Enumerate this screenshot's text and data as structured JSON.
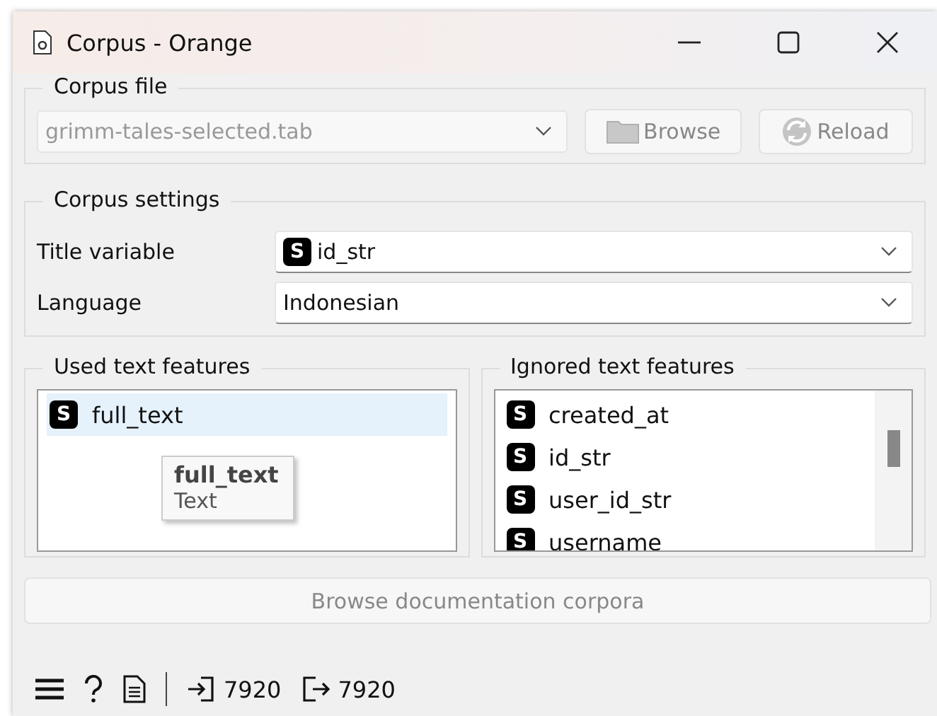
{
  "window": {
    "title": "Corpus - Orange"
  },
  "corpus_file": {
    "title": "Corpus file",
    "file": "grimm-tales-selected.tab",
    "disabled": true,
    "buttons": [
      {
        "label": "Browse",
        "kind": "folder"
      },
      {
        "label": "Reload",
        "kind": "reload"
      }
    ]
  },
  "corpus_settings": {
    "title": "Corpus settings",
    "fields": [
      {
        "label": "Title variable",
        "value": "id_str",
        "type": "S"
      },
      {
        "label": "Language",
        "value": "Indonesian"
      }
    ]
  },
  "used_features": {
    "title": "Used text features",
    "items": [
      {
        "type": "S",
        "name": "full_text",
        "selected": true
      }
    ]
  },
  "tooltip": {
    "title": "full_text",
    "subtitle": "Text"
  },
  "ignored_features": {
    "title": "Ignored text features",
    "items": [
      {
        "type": "S",
        "name": "created_at",
        "selected": false
      },
      {
        "type": "S",
        "name": "id_str",
        "selected": false
      },
      {
        "type": "S",
        "name": "user_id_str",
        "selected": false
      },
      {
        "type": "S",
        "name": "username",
        "selected": false
      }
    ]
  },
  "browse_docs": {
    "label": "Browse documentation corpora",
    "disabled": true
  },
  "status_bar": {
    "input_count": "7920",
    "output_count": "7920"
  }
}
